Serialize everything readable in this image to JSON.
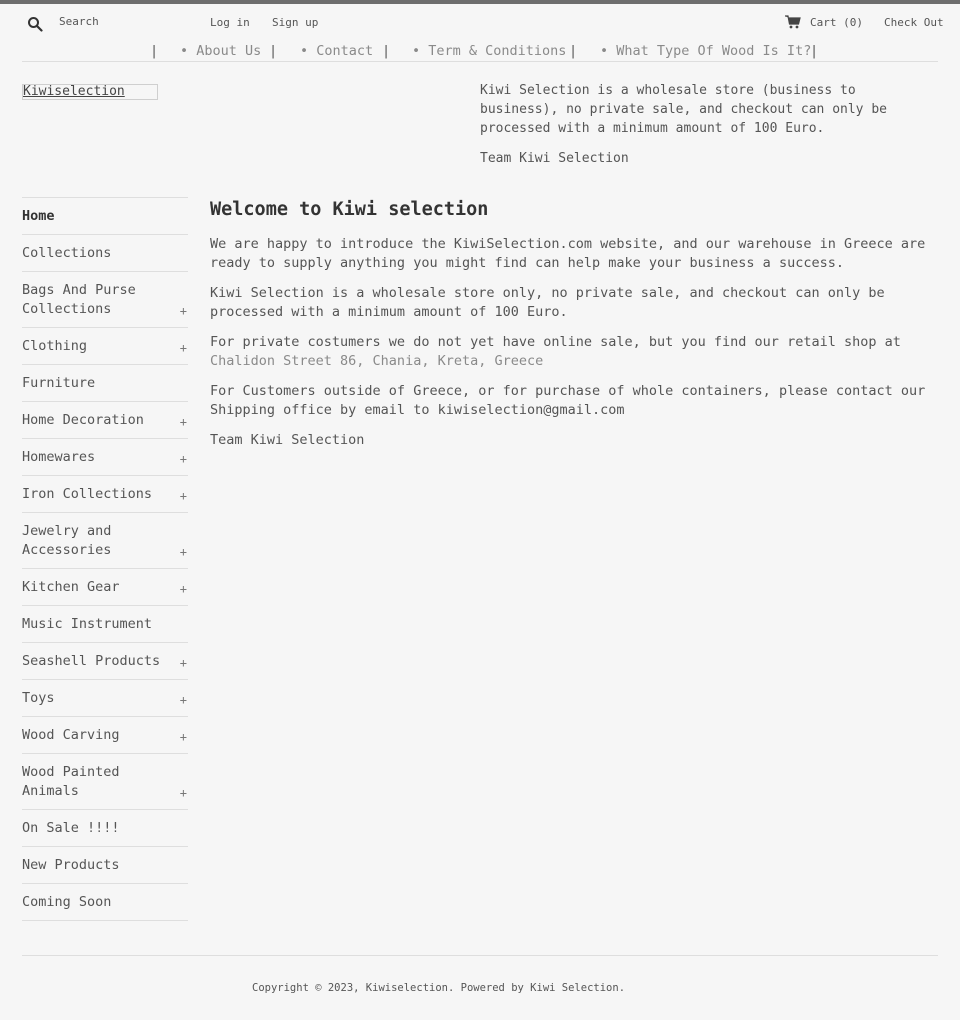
{
  "header": {
    "search_placeholder": "Search",
    "login_label": "Log in",
    "signup_label": "Sign up",
    "cart_label": "Cart (0)",
    "checkout_label": "Check Out"
  },
  "nav": {
    "separator": "|",
    "items": [
      {
        "label": "• About Us"
      },
      {
        "label": "• Contact"
      },
      {
        "label": "• Term & Conditions"
      },
      {
        "label": "• What Type Of Wood Is It?"
      }
    ]
  },
  "logo": {
    "text": "Kiwiselection"
  },
  "notice": {
    "paragraphs": [
      "Kiwi Selection is a wholesale store (business to business), no private sale, and checkout can only be processed with a minimum amount of 100 Euro.",
      "Team Kiwi Selection"
    ]
  },
  "sidebar": {
    "items": [
      {
        "label": "Home",
        "active": true,
        "expandable": false
      },
      {
        "label": "Collections",
        "expandable": false
      },
      {
        "label": "Bags And Purse Collections",
        "expandable": true
      },
      {
        "label": "Clothing",
        "expandable": true
      },
      {
        "label": "Furniture",
        "expandable": false
      },
      {
        "label": "Home Decoration",
        "expandable": true
      },
      {
        "label": "Homewares",
        "expandable": true
      },
      {
        "label": "Iron Collections",
        "expandable": true
      },
      {
        "label": "Jewelry and Accessories",
        "expandable": true
      },
      {
        "label": "Kitchen Gear",
        "expandable": true
      },
      {
        "label": "Music Instrument",
        "expandable": false
      },
      {
        "label": "Seashell Products",
        "expandable": true
      },
      {
        "label": "Toys",
        "expandable": true
      },
      {
        "label": "Wood Carving",
        "expandable": true
      },
      {
        "label": "Wood Painted Animals",
        "expandable": true
      },
      {
        "label": "On Sale !!!!",
        "expandable": false
      },
      {
        "label": "New Products",
        "expandable": false
      },
      {
        "label": "Coming Soon",
        "expandable": false
      }
    ],
    "expand_symbol": "+"
  },
  "main": {
    "title": "Welcome to Kiwi selection",
    "p1": "We are happy to introduce the KiwiSelection.com website, and our warehouse in Greece are ready to supply anything you might find can help make your business a success.",
    "p2_line1": "Kiwi Selection is a wholesale store only, no private sale, and checkout can only be",
    "p2_line2": "processed with a minimum amount of 100 Euro.",
    "p3_text": "For private costumers we do not yet have online sale, but you find our retail shop at",
    "p3_address": "Chalidon Street 86, Chania, Kreta, Greece",
    "p4": "For Customers outside of Greece, or for purchase of whole containers, please contact our Shipping office by email to kiwiselection@gmail.com",
    "p5": "Team Kiwi Selection"
  },
  "footer": {
    "prefix": "Copyright © 2023, ",
    "shop_link": "Kiwiselection",
    "middle": ". Powered by ",
    "powered_link": "Kiwi Selection",
    "suffix": "."
  }
}
